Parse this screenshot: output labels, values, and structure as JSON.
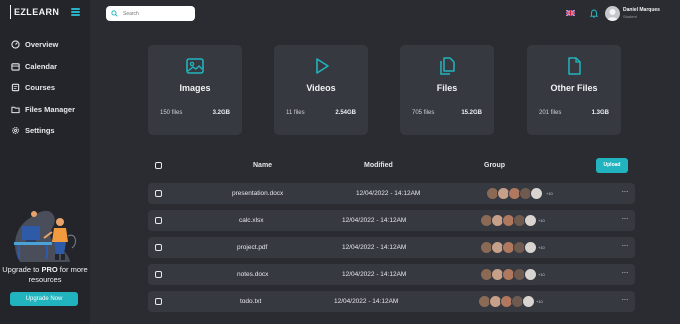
{
  "app": {
    "logo": "EZLEARN"
  },
  "nav": [
    {
      "label": "Overview",
      "icon": "gauge-icon"
    },
    {
      "label": "Calendar",
      "icon": "calendar-icon"
    },
    {
      "label": "Courses",
      "icon": "book-icon"
    },
    {
      "label": "Files Manager",
      "icon": "folder-icon"
    },
    {
      "label": "Settings",
      "icon": "gear-icon"
    }
  ],
  "promo": {
    "text_before": "Upgrade to ",
    "text_bold": "PRO",
    "text_after": " for more resources",
    "button": "Upgrade Now"
  },
  "search": {
    "placeholder": "Search"
  },
  "user": {
    "name": "Daniel Marques",
    "role": "Student"
  },
  "cards": [
    {
      "title": "Images",
      "count": "150 files",
      "size": "3.2GB",
      "icon": "image-icon"
    },
    {
      "title": "Videos",
      "count": "11 files",
      "size": "2.54GB",
      "icon": "play-icon"
    },
    {
      "title": "Files",
      "count": "705 files",
      "size": "15.2GB",
      "icon": "files-icon"
    },
    {
      "title": "Other Files",
      "count": "201 files",
      "size": "1.3GB",
      "icon": "file-icon"
    }
  ],
  "table": {
    "columns": {
      "name": "Name",
      "modified": "Modified",
      "group": "Group"
    },
    "upload": "Upload",
    "rows": [
      {
        "name": "presentation.docx",
        "modified": "12/04/2022 - 14:12AM",
        "extra": "+10"
      },
      {
        "name": "calc.xlsx",
        "modified": "12/04/2022 - 14:12AM",
        "extra": "+10"
      },
      {
        "name": "project.pdf",
        "modified": "12/04/2022 - 14:12AM",
        "extra": "+10"
      },
      {
        "name": "notes.docx",
        "modified": "12/04/2022 - 14:12AM",
        "extra": "+10"
      },
      {
        "name": "todo.txt",
        "modified": "12/04/2022 - 14:12AM",
        "extra": "+10"
      }
    ],
    "more": "···"
  },
  "colors": {
    "accent": "#21b4be",
    "background": "#2a2c31",
    "sidebar": "#23252a",
    "card": "#363940"
  }
}
